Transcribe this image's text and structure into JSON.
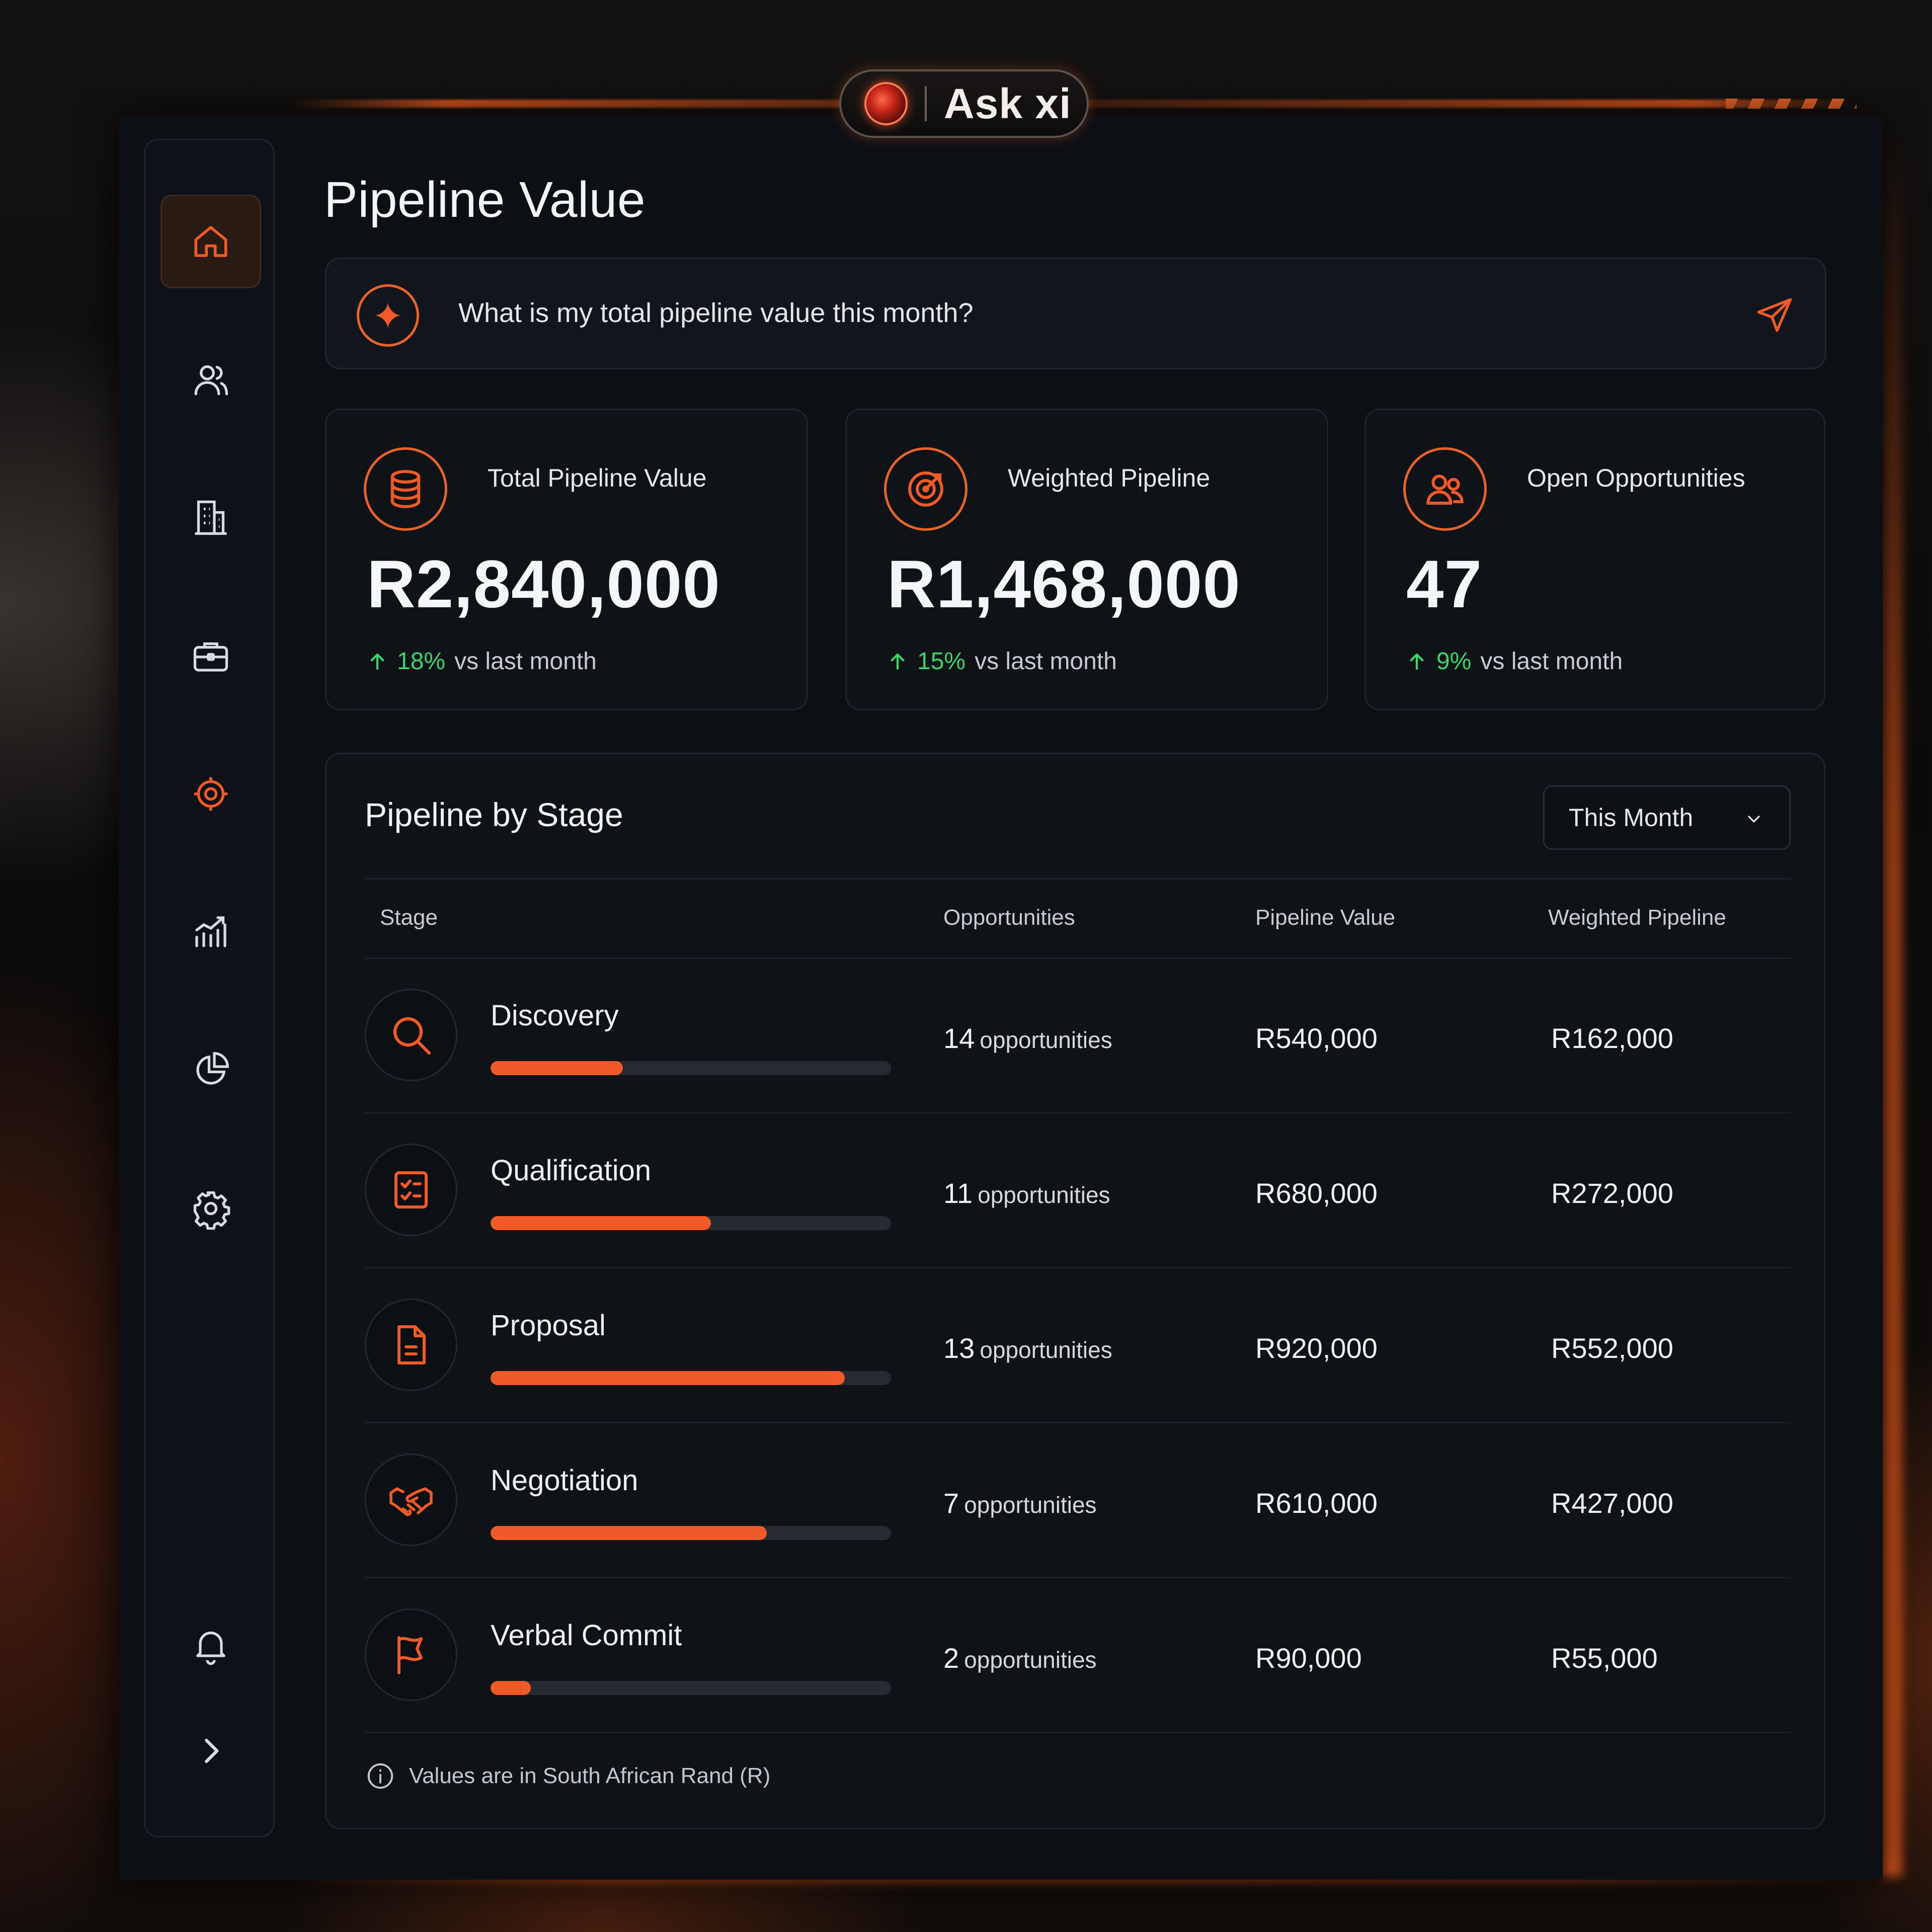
{
  "badge": {
    "label": "Ask xi"
  },
  "page": {
    "title": "Pipeline Value"
  },
  "ask": {
    "question": "What is my total pipeline value this month?"
  },
  "sidebar": {
    "items": [
      {
        "name": "home",
        "icon": "home-icon",
        "active": true
      },
      {
        "name": "contacts",
        "icon": "users-icon"
      },
      {
        "name": "companies",
        "icon": "building-icon"
      },
      {
        "name": "deals",
        "icon": "briefcase-icon"
      },
      {
        "name": "targets",
        "icon": "crosshair-icon"
      },
      {
        "name": "analytics",
        "icon": "bar-chart-icon"
      },
      {
        "name": "reports",
        "icon": "pie-chart-icon"
      },
      {
        "name": "settings",
        "icon": "gear-icon"
      },
      {
        "name": "notifications",
        "icon": "bell-icon"
      },
      {
        "name": "expand",
        "icon": "chevron-right-icon"
      }
    ]
  },
  "stats": [
    {
      "label": "Total Pipeline Value",
      "value": "R2,840,000",
      "delta": "18%",
      "delta_suffix": "vs last month",
      "icon": "database-icon"
    },
    {
      "label": "Weighted Pipeline",
      "value": "R1,468,000",
      "delta": "15%",
      "delta_suffix": "vs last month",
      "icon": "target-icon"
    },
    {
      "label": "Open Opportunities",
      "value": "47",
      "delta": "9%",
      "delta_suffix": "vs last month",
      "icon": "users-icon"
    }
  ],
  "table": {
    "title": "Pipeline by Stage",
    "period": "This Month",
    "headers": {
      "stage": "Stage",
      "opportunities": "Opportunities",
      "pipeline_value": "Pipeline Value",
      "weighted_pipeline": "Weighted Pipeline"
    },
    "unit_label": "opportunities",
    "rows": [
      {
        "stage": "Discovery",
        "count": "14",
        "pipeline_value": "R540,000",
        "weighted_pipeline": "R162,000",
        "progress": 0.33,
        "icon": "search-icon"
      },
      {
        "stage": "Qualification",
        "count": "11",
        "pipeline_value": "R680,000",
        "weighted_pipeline": "R272,000",
        "progress": 0.55,
        "icon": "checklist-icon"
      },
      {
        "stage": "Proposal",
        "count": "13",
        "pipeline_value": "R920,000",
        "weighted_pipeline": "R552,000",
        "progress": 0.885,
        "icon": "document-icon"
      },
      {
        "stage": "Negotiation",
        "count": "7",
        "pipeline_value": "R610,000",
        "weighted_pipeline": "R427,000",
        "progress": 0.69,
        "icon": "handshake-icon"
      },
      {
        "stage": "Verbal Commit",
        "count": "2",
        "pipeline_value": "R90,000",
        "weighted_pipeline": "R55,000",
        "progress": 0.1,
        "icon": "flag-icon"
      }
    ],
    "footnote": "Values are in South African Rand (R)"
  },
  "colors": {
    "accent": "#f05a28",
    "positive": "#3fd46a",
    "background": "#0c0f14"
  }
}
